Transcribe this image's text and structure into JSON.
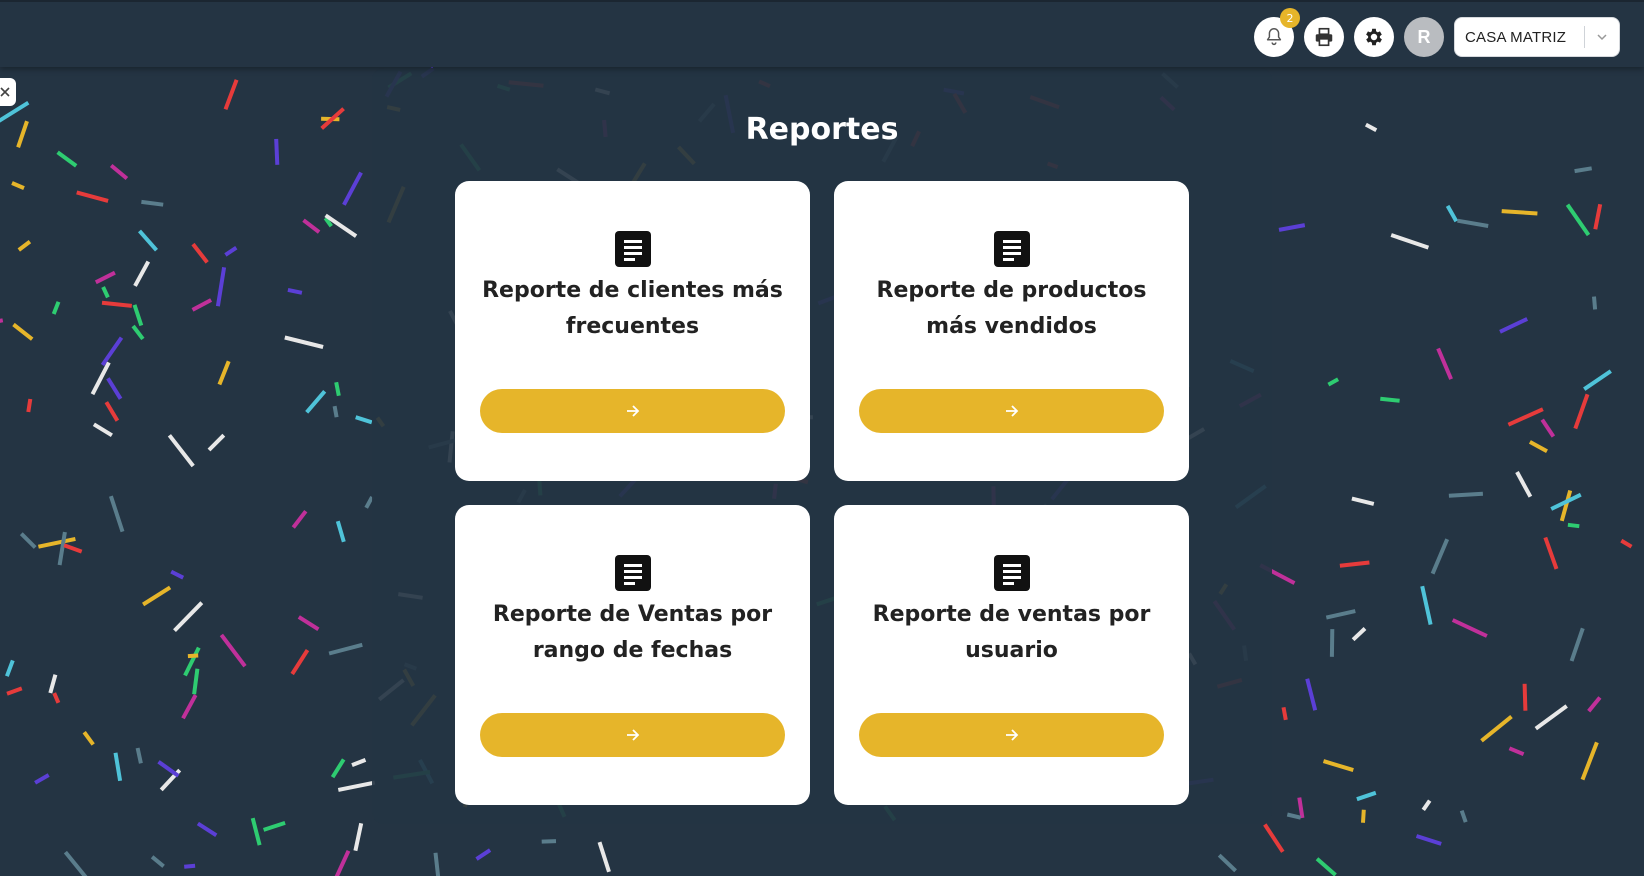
{
  "header": {
    "notifications": {
      "icon": "bell-icon",
      "count": "2"
    },
    "print_icon": "printer-icon",
    "settings_icon": "gear-icon",
    "avatar_initial": "R",
    "branch": {
      "value": "CASA MATRIZ",
      "icon": "chevron-down-icon"
    }
  },
  "sidebar_toggle_icon": "close-icon",
  "main": {
    "title": "Reportes",
    "cards": [
      {
        "icon": "document-icon",
        "title": "Reporte de clientes más frecuentes",
        "button_icon": "arrow-right-icon"
      },
      {
        "icon": "document-icon",
        "title": "Reporte de productos más vendidos",
        "button_icon": "arrow-right-icon"
      },
      {
        "icon": "document-icon",
        "title": "Reporte de Ventas por rango de fechas",
        "button_icon": "arrow-right-icon"
      },
      {
        "icon": "document-icon",
        "title": "Reporte de ventas por usuario",
        "button_icon": "arrow-right-icon"
      }
    ]
  },
  "colors": {
    "background": "#243443",
    "accent": "#e6b52a",
    "card": "#ffffff"
  }
}
